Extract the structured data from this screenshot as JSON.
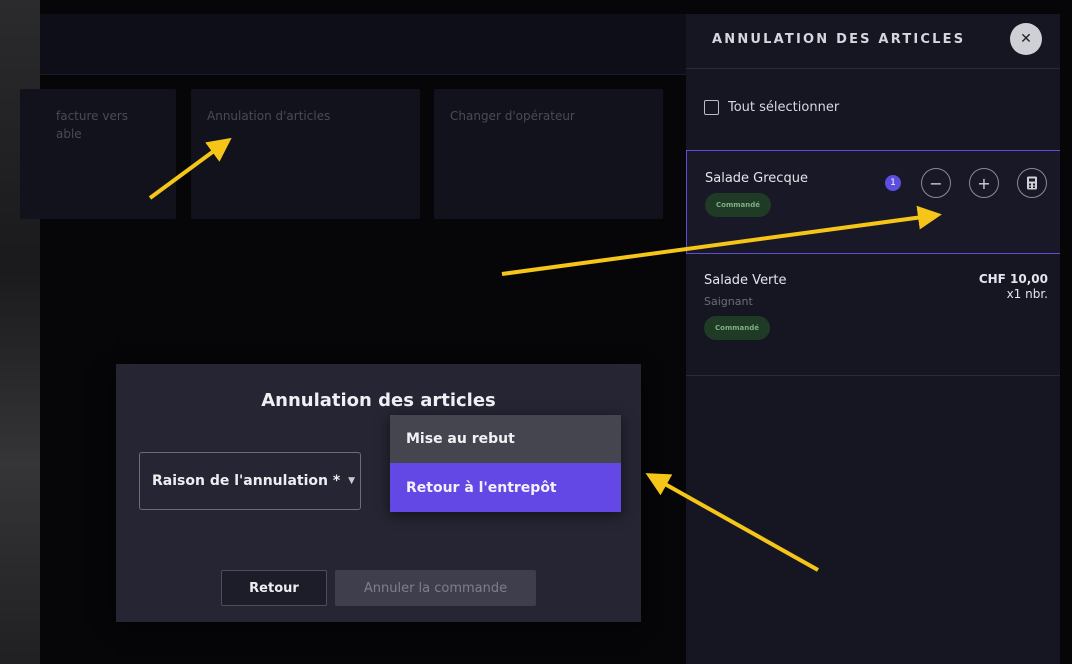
{
  "tiles": [
    {
      "label": "facture vers\nable"
    },
    {
      "label": "Annulation d'articles"
    },
    {
      "label": "Changer d'opérateur"
    }
  ],
  "panel": {
    "title": "ANNULATION DES ARTICLES",
    "close_icon": "close-icon",
    "select_all": "Tout sélectionner",
    "items": [
      {
        "name": "Salade Grecque",
        "status": "Commandé",
        "qty": "1",
        "minus": "−",
        "plus": "+",
        "calc_icon": "calculator-icon"
      },
      {
        "name": "Salade Verte",
        "modifier": "Saignant",
        "status": "Commandé",
        "price": "CHF 10,00",
        "qty_text": "x1 nbr."
      }
    ]
  },
  "modal": {
    "title": "Annulation des articles",
    "reason_label": "Raison de l'annulation *",
    "options": [
      "Mise au rebut",
      "Retour à l'entrepôt"
    ],
    "back_label": "Retour",
    "cancel_order_label": "Annuler la commande"
  },
  "colors": {
    "accent": "#6448e6",
    "arrow": "#f5c518",
    "badge_bg": "#1f3a25"
  }
}
